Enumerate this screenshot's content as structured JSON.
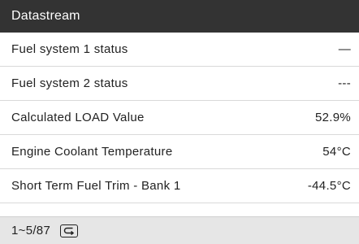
{
  "header": {
    "title": "Datastream"
  },
  "rows": [
    {
      "label": "Fuel system 1 status",
      "value": "—"
    },
    {
      "label": "Fuel system 2 status",
      "value": "---"
    },
    {
      "label": "Calculated LOAD Value",
      "value": "52.9%"
    },
    {
      "label": "Engine Coolant Temperature",
      "value": "54°C"
    },
    {
      "label": "Short Term Fuel Trim - Bank 1",
      "value": "-44.5°C"
    }
  ],
  "footer": {
    "page_indicator": "1~5/87",
    "back_icon": "return-icon"
  },
  "colors": {
    "title_bar": "#333333",
    "footer": "#e6e6e6",
    "divider": "#d9d9d9"
  }
}
